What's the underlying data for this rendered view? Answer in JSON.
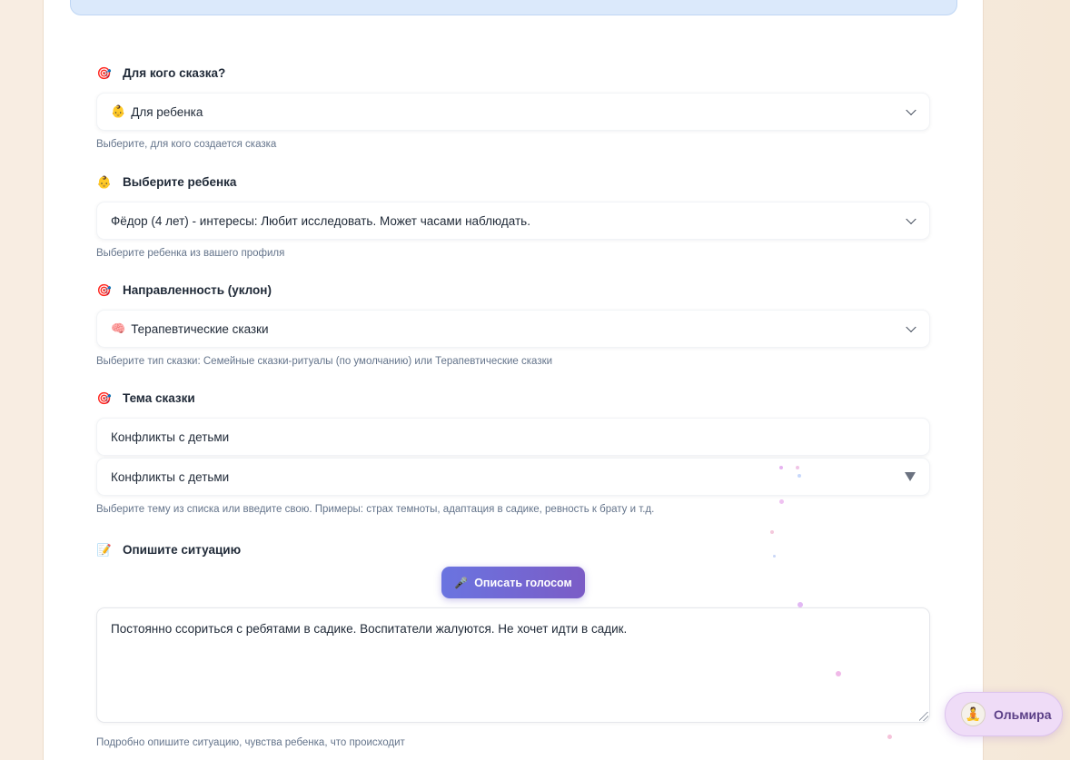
{
  "form": {
    "audience": {
      "icon": "🎯",
      "label": "Для кого сказка?",
      "selected_icon": "👶",
      "selected": "Для ребенка",
      "hint": "Выберите, для кого создается сказка"
    },
    "child": {
      "icon": "👶",
      "label": "Выберите ребенка",
      "selected": "Фёдор (4 лет) - интересы: Любит исследовать. Может часами наблюдать.",
      "hint": "Выберите ребенка из вашего профиля"
    },
    "direction": {
      "icon": "🎯",
      "label": "Направленность (уклон)",
      "selected_icon": "🧠",
      "selected": "Терапевтические сказки",
      "hint": "Выберите тип сказки: Семейные сказки-ритуалы (по умолчанию) или Терапевтические сказки"
    },
    "theme": {
      "icon": "🎯",
      "label": "Тема сказки",
      "input_value": "Конфликты с детьми",
      "selected": "Конфликты с детьми",
      "hint": "Выберите тему из списка или введите свою. Примеры: страх темноты, адаптация в садике, ревность к брату и т.д."
    },
    "situation": {
      "icon": "📝",
      "label": "Опишите ситуацию",
      "voice_button_icon": "🎤",
      "voice_button_label": "Описать голосом",
      "value": "Постоянно ссориться  с ребятами в садике. Воспитатели жалуются. Не хочет идти в садик.",
      "hint": "Подробно опишите ситуацию, чувства ребенка, что происходит"
    }
  },
  "assistant": {
    "avatar_icon": "🧘",
    "name": "Ольмира"
  }
}
